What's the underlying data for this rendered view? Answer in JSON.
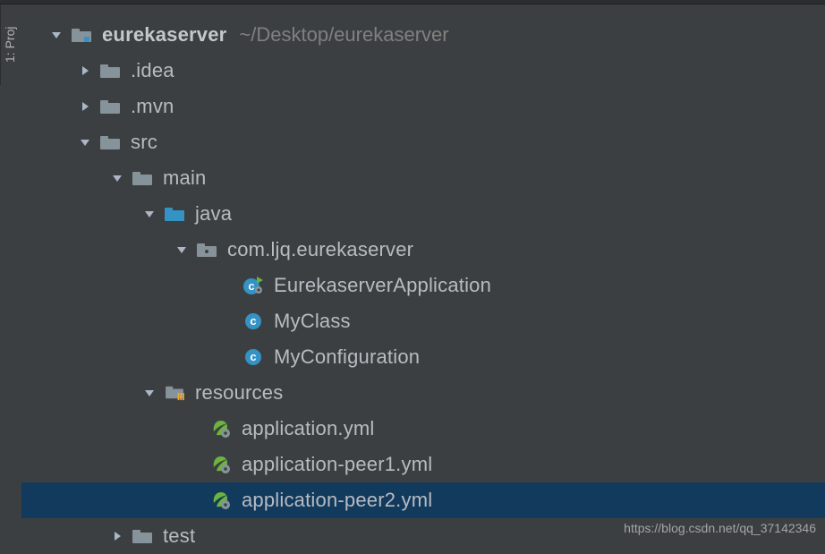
{
  "sideTab": "1: Proj",
  "root": {
    "name": "eurekaserver",
    "path": "~/Desktop/eurekaserver"
  },
  "nodes": {
    "idea": ".idea",
    "mvn": ".mvn",
    "src": "src",
    "main": "main",
    "java": "java",
    "package": "com.ljq.eurekaserver",
    "app": "EurekaserverApplication",
    "myclass": "MyClass",
    "myconfig": "MyConfiguration",
    "resources": "resources",
    "yml0": "application.yml",
    "yml1": "application-peer1.yml",
    "yml2": "application-peer2.yml",
    "test": "test"
  },
  "watermark": "https://blog.csdn.net/qq_37142346"
}
